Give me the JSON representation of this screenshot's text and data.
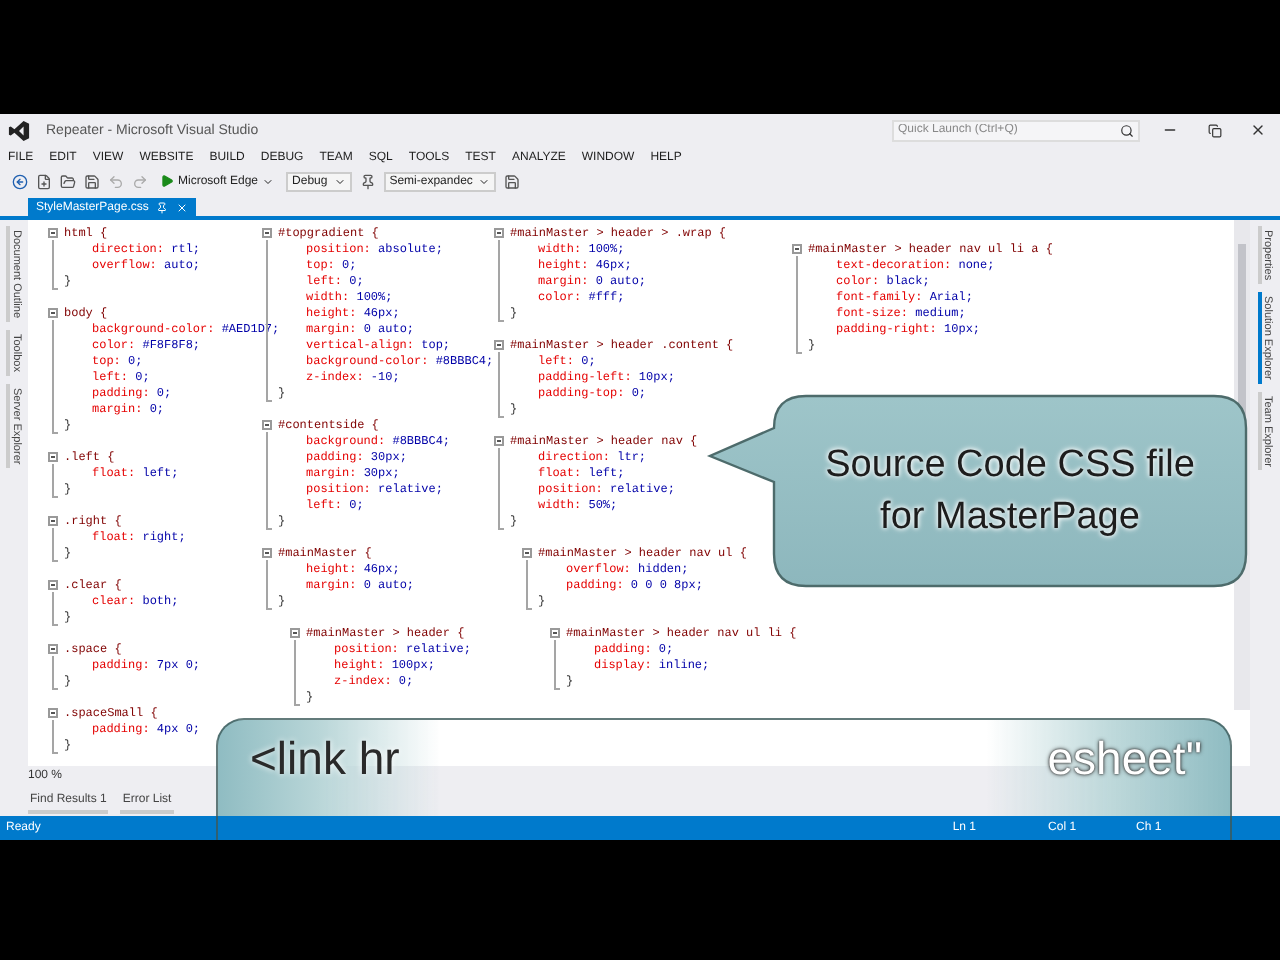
{
  "window": {
    "title": "Repeater - Microsoft Visual Studio",
    "quick_launch": {
      "placeholder": "Quick Launch (Ctrl+Q)"
    }
  },
  "menu": [
    "FILE",
    "EDIT",
    "VIEW",
    "WEBSITE",
    "BUILD",
    "DEBUG",
    "TEAM",
    "SQL",
    "TOOLS",
    "TEST",
    "ANALYZE",
    "WINDOW",
    "HELP"
  ],
  "toolbar": [
    {
      "kind": "run",
      "label": "Microsoft Edge"
    },
    {
      "kind": "dropdown",
      "label": "Debug"
    },
    {
      "kind": "dropdown",
      "label": "Semi-expandec"
    }
  ],
  "left_panels": [
    {
      "label": "Document Outline",
      "selected": false
    },
    {
      "label": "Toolbox",
      "selected": false
    },
    {
      "label": "Server Explorer",
      "selected": false
    }
  ],
  "right_panels": [
    {
      "label": "Properties",
      "selected": false
    },
    {
      "label": "Solution Explorer",
      "selected": true
    },
    {
      "label": "Team Explorer",
      "selected": false
    }
  ],
  "document_tab": {
    "title": "StyleMasterPage.css"
  },
  "editor": {
    "zoom": "100 %",
    "columns": [
      {
        "rules": [
          {
            "selector": "html {",
            "declarations": [
              {
                "property": "direction:",
                "value": "rtl;"
              },
              {
                "property": "overflow:",
                "value": "auto;"
              }
            ],
            "close": "}"
          },
          {
            "selector": "body {",
            "declarations": [
              {
                "property": "background-color:",
                "value": "#AED1D7;"
              },
              {
                "property": "color:",
                "value": "#F8F8F8;"
              },
              {
                "property": "top:",
                "value": "0;"
              },
              {
                "property": "left:",
                "value": "0;"
              },
              {
                "property": "padding:",
                "value": "0;"
              },
              {
                "property": "margin:",
                "value": "0;"
              }
            ],
            "close": "}"
          },
          {
            "selector": ".left {",
            "declarations": [
              {
                "property": "float:",
                "value": "left;"
              }
            ],
            "close": "}"
          },
          {
            "selector": ".right {",
            "declarations": [
              {
                "property": "float:",
                "value": "right;"
              }
            ],
            "close": "}"
          },
          {
            "selector": ".clear {",
            "declarations": [
              {
                "property": "clear:",
                "value": "both;"
              }
            ],
            "close": "}"
          },
          {
            "selector": ".space {",
            "declarations": [
              {
                "property": "padding:",
                "value": "7px 0;"
              }
            ],
            "close": "}"
          },
          {
            "selector": ".spaceSmall {",
            "declarations": [
              {
                "property": "padding:",
                "value": "4px 0;"
              }
            ],
            "close": "}"
          }
        ]
      },
      {
        "rules": [
          {
            "selector": "#topgradient {",
            "declarations": [
              {
                "property": "position:",
                "value": "absolute;"
              },
              {
                "property": "top:",
                "value": "0;"
              },
              {
                "property": "left:",
                "value": "0;"
              },
              {
                "property": "width:",
                "value": "100%;"
              },
              {
                "property": "height:",
                "value": "46px;"
              },
              {
                "property": "margin:",
                "value": "0 auto;"
              },
              {
                "property": "vertical-align:",
                "value": "top;"
              },
              {
                "property": "background-color:",
                "value": "#8BBBC4;"
              },
              {
                "property": "z-index:",
                "value": "-10;"
              }
            ],
            "close": "}"
          },
          {
            "selector": "#contentside {",
            "declarations": [
              {
                "property": "background:",
                "value": "#8BBBC4;"
              },
              {
                "property": "padding:",
                "value": "30px;"
              },
              {
                "property": "margin:",
                "value": "30px;"
              },
              {
                "property": "position:",
                "value": "relative;"
              },
              {
                "property": "left:",
                "value": "0;"
              }
            ],
            "close": "}"
          },
          {
            "selector": "#mainMaster {",
            "declarations": [
              {
                "property": "height:",
                "value": "46px;"
              },
              {
                "property": "margin:",
                "value": "0 auto;"
              }
            ],
            "close": "}",
            "children": [
              {
                "selector": "#mainMaster > header {",
                "declarations": [
                  {
                    "property": "position:",
                    "value": "relative;"
                  },
                  {
                    "property": "height:",
                    "value": "100px;"
                  },
                  {
                    "property": "z-index:",
                    "value": "0;"
                  }
                ],
                "close": "}"
              }
            ]
          }
        ]
      },
      {
        "rules": [
          {
            "selector": "#mainMaster > header > .wrap {",
            "declarations": [
              {
                "property": "width:",
                "value": "100%;"
              },
              {
                "property": "height:",
                "value": "46px;"
              },
              {
                "property": "margin:",
                "value": "0 auto;"
              },
              {
                "property": "color:",
                "value": "#fff;"
              }
            ],
            "close": "}"
          },
          {
            "selector": "#mainMaster > header .content {",
            "declarations": [
              {
                "property": "left:",
                "value": "0;"
              },
              {
                "property": "padding-left:",
                "value": "10px;"
              },
              {
                "property": "padding-top:",
                "value": "0;"
              }
            ],
            "close": "}"
          },
          {
            "selector": "#mainMaster > header nav {",
            "declarations": [
              {
                "property": "direction:",
                "value": "ltr;"
              },
              {
                "property": "float:",
                "value": "left;"
              },
              {
                "property": "position:",
                "value": "relative;"
              },
              {
                "property": "width:",
                "value": "50%;"
              }
            ],
            "close": "}",
            "children": [
              {
                "selector": "#mainMaster > header nav ul {",
                "declarations": [
                  {
                    "property": "overflow:",
                    "value": "hidden;"
                  },
                  {
                    "property": "padding:",
                    "value": "0 0 0 8px;"
                  }
                ],
                "close": "}",
                "children": [
                  {
                    "selector": "#mainMaster > header nav ul li {",
                    "declarations": [
                      {
                        "property": "padding:",
                        "value": "0;"
                      },
                      {
                        "property": "display:",
                        "value": "inline;"
                      }
                    ],
                    "close": "}"
                  }
                ]
              }
            ]
          }
        ]
      },
      {
        "rules": [
          {
            "selector": "#mainMaster > header nav ul li a {",
            "declarations": [
              {
                "property": "text-decoration:",
                "value": "none;"
              },
              {
                "property": "color:",
                "value": "black;"
              },
              {
                "property": "font-family:",
                "value": "Arial;"
              },
              {
                "property": "font-size:",
                "value": "medium;"
              },
              {
                "property": "padding-right:",
                "value": "10px;"
              }
            ],
            "close": "}"
          }
        ]
      }
    ]
  },
  "output_tabs": [
    "Find Results 1",
    "Error List"
  ],
  "status_bar": {
    "message": "Ready",
    "line": "Ln 1",
    "column": "Col 1",
    "char": "Ch 1"
  },
  "callouts": [
    {
      "kind": "speech",
      "lines": [
        "Source Code CSS file",
        "for MasterPage"
      ]
    },
    {
      "kind": "banner",
      "start": "<link hr",
      "end": "esheet\""
    }
  ]
}
